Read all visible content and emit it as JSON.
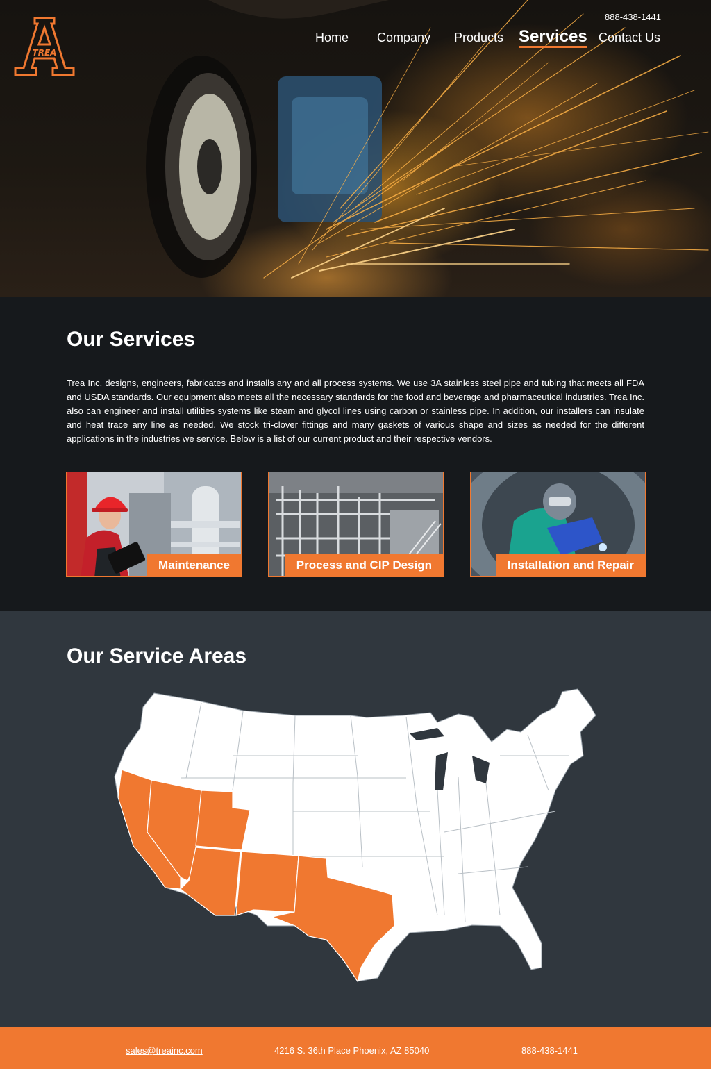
{
  "header": {
    "logo_text": "TREA",
    "phone": "888-438-1441",
    "nav": [
      {
        "label": "Home"
      },
      {
        "label": "Company"
      },
      {
        "label": "Products"
      },
      {
        "label": "Services",
        "active": true
      },
      {
        "label": "Contact Us"
      }
    ]
  },
  "services": {
    "title": "Our Services",
    "description": "Trea Inc. designs, engineers, fabricates and installs any and all process systems. We use 3A stainless steel pipe and tubing that meets all FDA and USDA standards. Our equipment also meets all the necessary standards for the food and beverage and pharmaceutical industries. Trea Inc. also can engineer and install utilities systems like steam and glycol lines using carbon or stainless pipe. In addition, our installers can insulate and heat trace any line as needed. We stock tri-clover fittings and many gaskets of various shape and sizes as needed for the different applications in the industries we service. Below is a list of our current product and their respective vendors.",
    "cards": [
      {
        "label": "Maintenance"
      },
      {
        "label": "Process and CIP Design"
      },
      {
        "label": "Installation and Repair"
      }
    ]
  },
  "areas": {
    "title": "Our Service Areas",
    "highlighted_states": [
      "California",
      "Nevada",
      "Utah",
      "Arizona",
      "New Mexico",
      "Texas"
    ]
  },
  "footer": {
    "email": "sales@treainc.com",
    "address": "4216 S. 36th Place Phoenix, AZ 85040",
    "phone": "888-438-1441"
  },
  "colors": {
    "accent": "#f07830",
    "services_bg": "#16191c",
    "areas_bg": "#30373e"
  }
}
